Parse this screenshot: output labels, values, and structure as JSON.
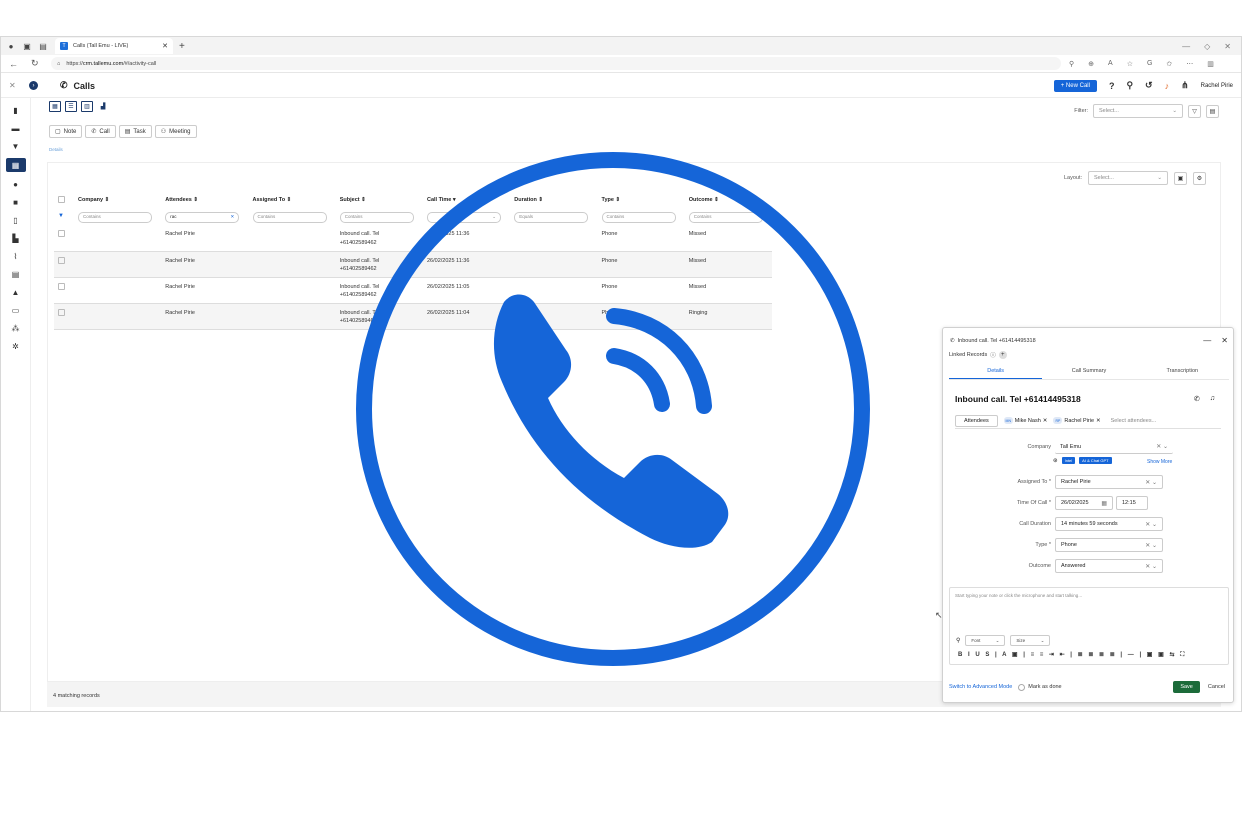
{
  "browser": {
    "tab_title": "Calls (Tall Emu - LIVE)",
    "url_prefix": "https://",
    "url_host": "crm.tallemu.com",
    "url_path": "/#/activity-call"
  },
  "header": {
    "page_title": "Calls",
    "new_call_label": "+ New Call",
    "user_name": "Rachel Pirie"
  },
  "toolbar": {
    "filter_label": "Filter:",
    "filter_placeholder": "Select...",
    "layout_label": "Layout:",
    "layout_placeholder": "Select...",
    "actions": [
      "Note",
      "Call",
      "Task",
      "Meeting"
    ],
    "details_link": "Details"
  },
  "grid": {
    "columns": [
      "Company ⇕",
      "Attendees ⇕",
      "Assigned To ⇕",
      "Subject ⇕",
      "Call Time ▾",
      "Duration ⇕",
      "Type ⇕",
      "Outcome ⇕"
    ],
    "filters": [
      "Contains",
      "rac",
      "Contains",
      "Contains",
      "",
      "Equals",
      "Contains",
      "Contains"
    ],
    "rows": [
      {
        "company": "",
        "attendees": "Rachel Pirie",
        "assigned": "",
        "subject1": "Inbound call. Tel",
        "subject2": "+61402589462",
        "time": "26/02/2025 11:36",
        "duration": "",
        "type": "Phone",
        "outcome": "Missed"
      },
      {
        "company": "",
        "attendees": "Rachel Pirie",
        "assigned": "",
        "subject1": "Inbound call. Tel",
        "subject2": "+61402589462",
        "time": "26/02/2025 11:36",
        "duration": "",
        "type": "Phone",
        "outcome": "Missed"
      },
      {
        "company": "",
        "attendees": "Rachel Pirie",
        "assigned": "",
        "subject1": "Inbound call. Tel",
        "subject2": "+61402589462",
        "time": "26/02/2025 11:05",
        "duration": "",
        "type": "Phone",
        "outcome": "Missed"
      },
      {
        "company": "",
        "attendees": "Rachel Pirie",
        "assigned": "",
        "subject1": "Inbound call. Tel",
        "subject2": "+61402589462",
        "time": "26/02/2025 11:04",
        "duration": "",
        "type": "Phone",
        "outcome": "Ringing"
      }
    ],
    "matching": "4 matching records"
  },
  "call_panel": {
    "header": "Inbound call. Tel +61414495318",
    "linked_records": "Linked Records",
    "tabs": [
      "Details",
      "Call Summary",
      "Transcription"
    ],
    "title": "Inbound call. Tel +61414495318",
    "attendees_button": "Attendees",
    "attendees": [
      {
        "initials": "MN",
        "name": "Mike Nash"
      },
      {
        "initials": "RP",
        "name": "Rachel Pirie"
      }
    ],
    "attendees_placeholder": "Select attendees...",
    "fields": {
      "company_label": "Company",
      "company_value": "Tall Emu",
      "ai_pill_1": "Intel",
      "ai_pill_2": "AI & Chat GPT",
      "show_more": "Show More",
      "assigned_label": "Assigned To *",
      "assigned_value": "Rachel Pirie",
      "time_label": "Time Of Call *",
      "time_date": "26/02/2025",
      "time_clock": "12:15",
      "duration_label": "Call Duration",
      "duration_value": "14 minutes 59 seconds",
      "type_label": "Type *",
      "type_value": "Phone",
      "outcome_label": "Outcome",
      "outcome_value": "Answered"
    },
    "note_placeholder": "Start typing your note or click the microphone and start talking...",
    "font_label": "Font",
    "size_label": "Size",
    "advanced_mode": "Switch to Advanced Mode",
    "mark_done": "Mark as done",
    "save": "Save",
    "cancel": "Cancel"
  },
  "colors": {
    "overlay_blue": "#1565d8",
    "brand_navy": "#1b3a6b",
    "save_green": "#1c6b3a"
  },
  "icons": {
    "overlay": "phone-ringing-icon"
  }
}
